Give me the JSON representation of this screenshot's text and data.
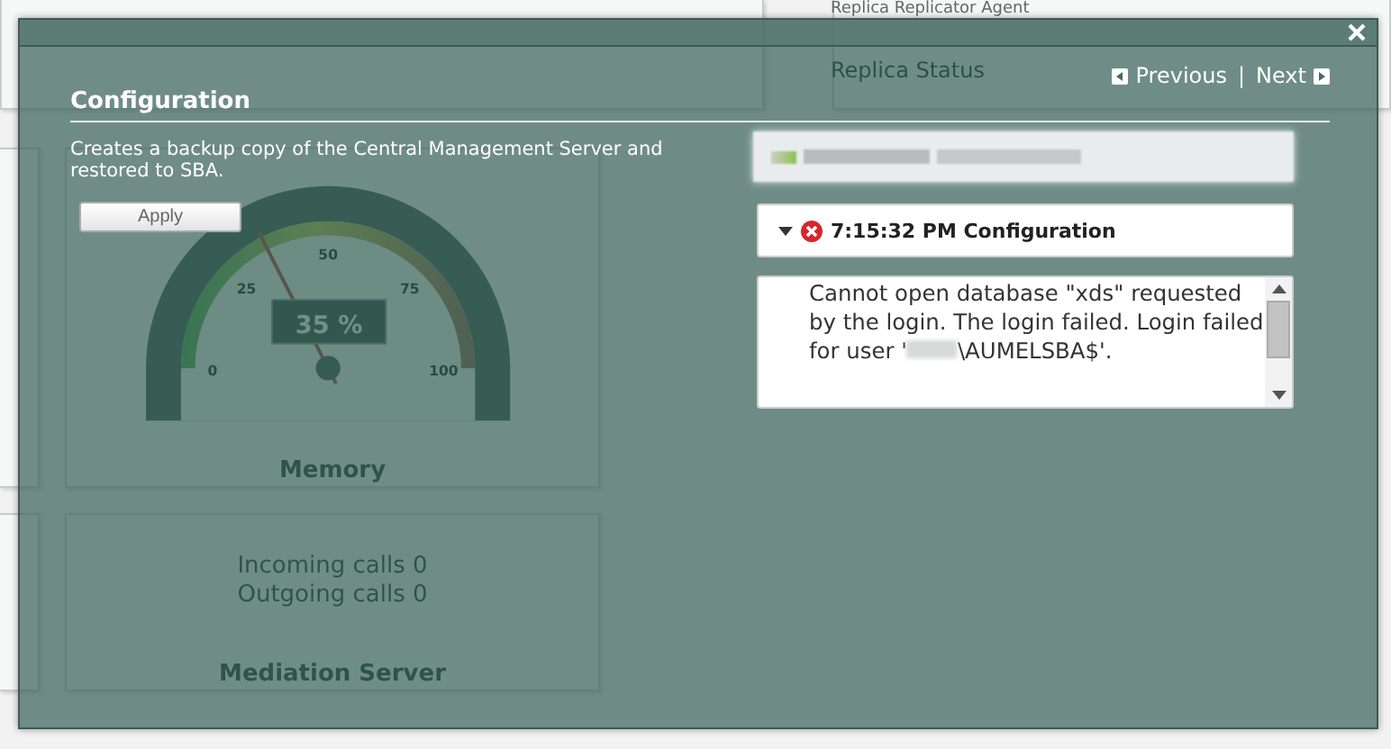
{
  "dashboard": {
    "replica_card": {
      "items": [
        "Replica Replicator Agent",
        "Replica Status"
      ]
    },
    "memory_card": {
      "title": "Memory",
      "gauge": {
        "level": 0.35,
        "reading": "35 %",
        "ticks": [
          "0",
          "25",
          "50",
          "75",
          "100"
        ]
      }
    },
    "mediation_card": {
      "title": "Mediation Server",
      "lines": [
        "Incoming calls 0",
        "Outgoing calls 0"
      ]
    }
  },
  "dialog": {
    "previous_link": "Previous",
    "separator": "|",
    "next_link": "Next",
    "title": "Configuration",
    "description": "Creates a backup copy of the Central Management Server and restored to SBA.",
    "apply_button": "Apply",
    "log_entry": {
      "expanded": true,
      "kind": "error",
      "heading": "7:15:32 PM Configuration",
      "message_before": "Cannot open database \"xds\" requested by the login. The login failed. Login failed for user '",
      "message_after": "\\AUMELSBA$'."
    }
  }
}
